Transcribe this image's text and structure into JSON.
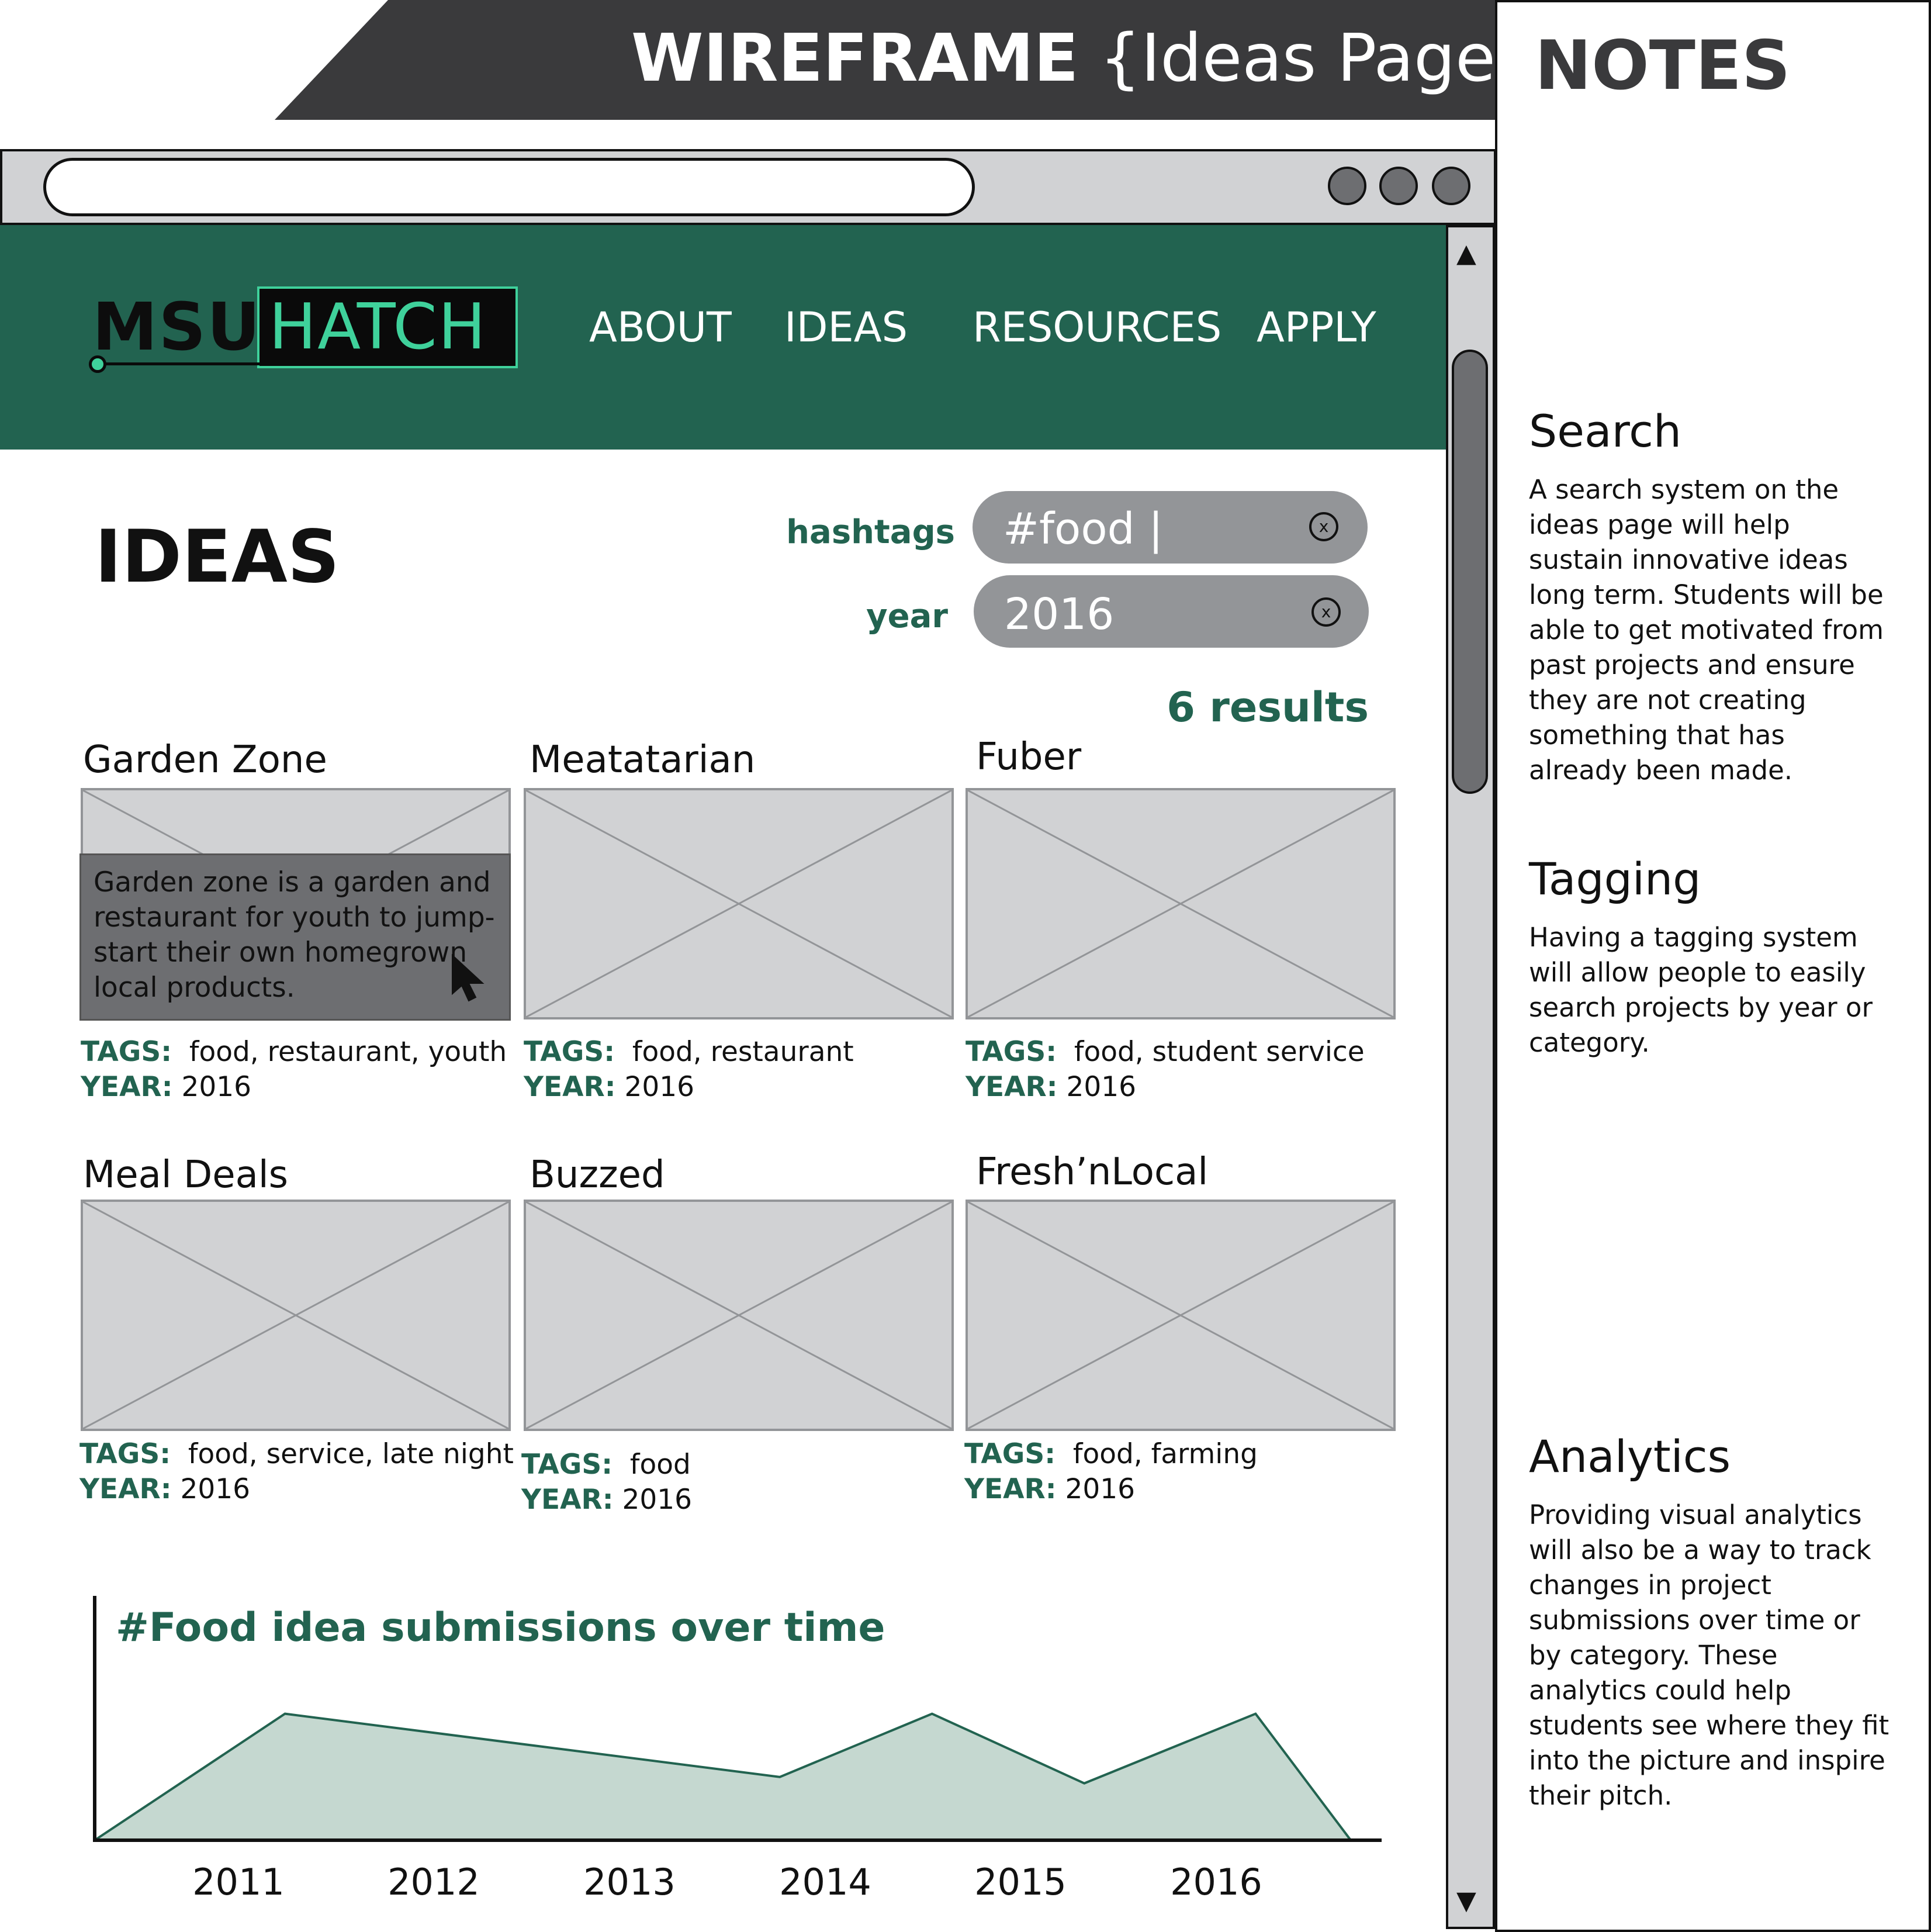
{
  "banner": {
    "title_bold": "WIREFRAME",
    "title_light": "{Ideas Page}"
  },
  "notes": {
    "title": "NOTES",
    "sections": [
      {
        "heading": "Search",
        "body": "A search system on the ideas page will help sustain innovative ideas long term. Students will be able to get motivated from past projects and ensure they are  not creating something that has already been made."
      },
      {
        "heading": "Tagging",
        "body": "Having a tagging system will allow people to easily search projects by year or category."
      },
      {
        "heading": "Analytics",
        "body": "Providing visual analytics will also be a way to track changes in project submissions over time or by category. These analytics could help students see where they fit into the picture and inspire their pitch."
      }
    ]
  },
  "site": {
    "logo_left": "MSU",
    "logo_right": "HATCH",
    "nav": [
      "ABOUT",
      "IDEAS",
      "RESOURCES",
      "APPLY"
    ]
  },
  "ideas": {
    "title": "IDEAS",
    "filters": {
      "hashtags_label": "hashtags",
      "hashtags_value": "#food |",
      "year_label": "year",
      "year_value": "2016",
      "clear_glyph": "x"
    },
    "results": "6 results",
    "tags_key": "TAGS:",
    "year_key": "YEAR:",
    "cards": [
      {
        "title": "Garden Zone",
        "tags": "food, restaurant, youth",
        "year": "2016",
        "description": "Garden zone is a garden and restaurant for youth to jump-start their own homegrown local products."
      },
      {
        "title": "Meatatarian",
        "tags": "food, restaurant",
        "year": "2016"
      },
      {
        "title": "Fuber",
        "tags": "food, student service",
        "year": "2016"
      },
      {
        "title": "Meal Deals",
        "tags": "food, service, late night",
        "year": "2016"
      },
      {
        "title": "Buzzed",
        "tags": "food",
        "year": "2016"
      },
      {
        "title": "Fresh’nLocal",
        "tags": "food, farming",
        "year": "2016"
      }
    ]
  },
  "colors": {
    "brand_green": "#226350",
    "accent_green": "#3fd19b",
    "chart_fill": "#c5d8d0",
    "banner_dark": "#3a3a3c"
  },
  "chart_data": {
    "type": "area",
    "title": "#Food idea submissions over time",
    "xlabel": "",
    "ylabel": "",
    "x": [
      2010.2,
      2011.2,
      2013.8,
      2014.6,
      2015.4,
      2016.3,
      2016.8
    ],
    "values": [
      0,
      1.0,
      0.5,
      1.0,
      0.45,
      1.0,
      0
    ],
    "xlim": [
      2010.2,
      2016.95
    ],
    "ylim": [
      0,
      1.1
    ],
    "x_ticks": [
      2011,
      2012,
      2013,
      2014,
      2015,
      2016
    ],
    "grid": false
  }
}
